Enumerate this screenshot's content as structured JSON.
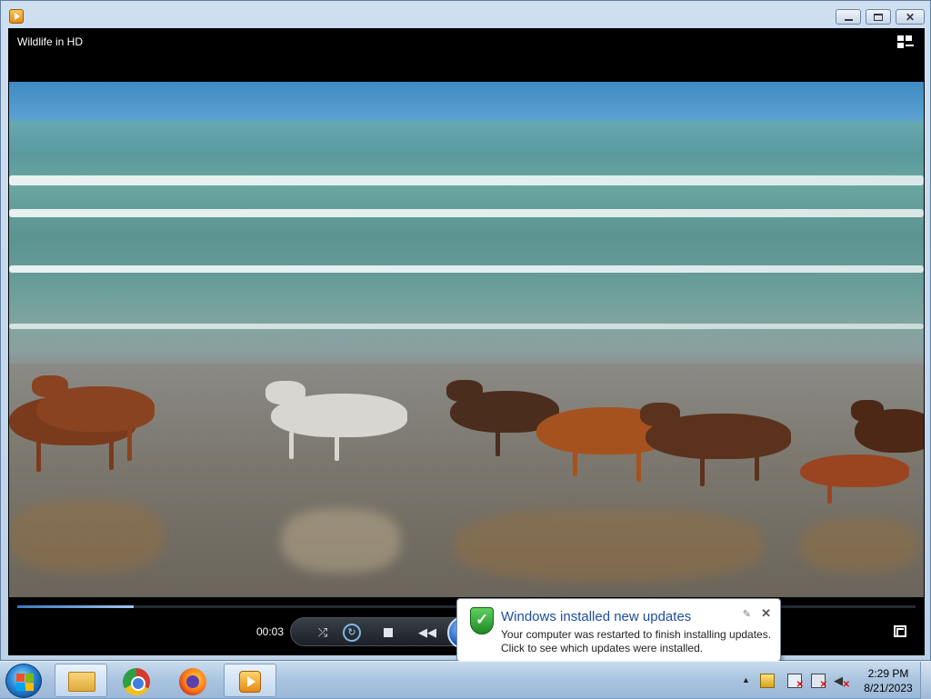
{
  "window": {
    "title_icon": "media-player-icon",
    "controls": {
      "minimize": "minimize",
      "maximize": "maximize",
      "close": "close"
    }
  },
  "player": {
    "now_playing": "Wildlife in HD",
    "elapsed": "00:03",
    "progress_fraction": 0.13
  },
  "notification": {
    "title": "Windows installed new updates",
    "line1": "Your computer was restarted to finish installing updates.",
    "line2": "Click to see which updates were installed."
  },
  "taskbar": {
    "items": [
      "Windows Explorer",
      "Google Chrome",
      "Mozilla Firefox",
      "Windows Media Player"
    ],
    "active_item": "Windows Media Player"
  },
  "clock": {
    "time": "2:29 PM",
    "date": "8/21/2023"
  }
}
